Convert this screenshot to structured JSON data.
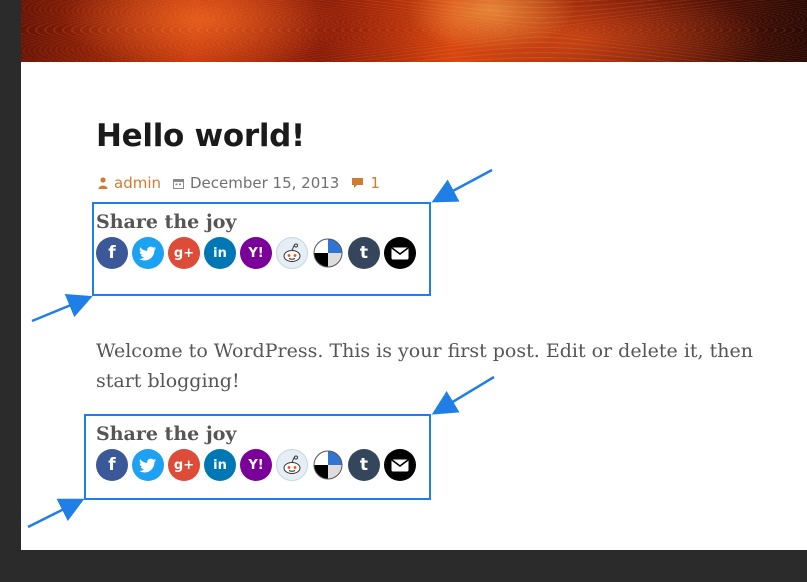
{
  "post": {
    "title": "Hello world!",
    "author": "admin",
    "date": "December 15, 2013",
    "comment_count": "1",
    "body": "Welcome to WordPress. This is your first post. Edit or delete it, then start blogging!"
  },
  "share_top": {
    "title": "Share the joy"
  },
  "share_bottom": {
    "title": "Share the joy"
  },
  "share_buttons": [
    {
      "name": "facebook-icon",
      "glyph": "f",
      "color": "#3b5998"
    },
    {
      "name": "twitter-icon",
      "glyph": "",
      "color": "#1da1f2"
    },
    {
      "name": "google-plus-icon",
      "glyph": "g+",
      "color": "#dd4b39"
    },
    {
      "name": "linkedin-icon",
      "glyph": "in",
      "color": "#0077b5"
    },
    {
      "name": "yahoo-icon",
      "glyph": "Y!",
      "color": "#7b0099"
    },
    {
      "name": "reddit-icon",
      "glyph": "",
      "color": "#e6eef5"
    },
    {
      "name": "delicious-icon",
      "glyph": "",
      "color": "#3274d1"
    },
    {
      "name": "tumblr-icon",
      "glyph": "t",
      "color": "#35465c"
    },
    {
      "name": "email-icon",
      "glyph": "",
      "color": "#000000"
    }
  ],
  "colors": {
    "accent_link": "#d07b2f",
    "annotation_blue": "#1f7fe6",
    "frame_dark": "#2b2b2b"
  }
}
